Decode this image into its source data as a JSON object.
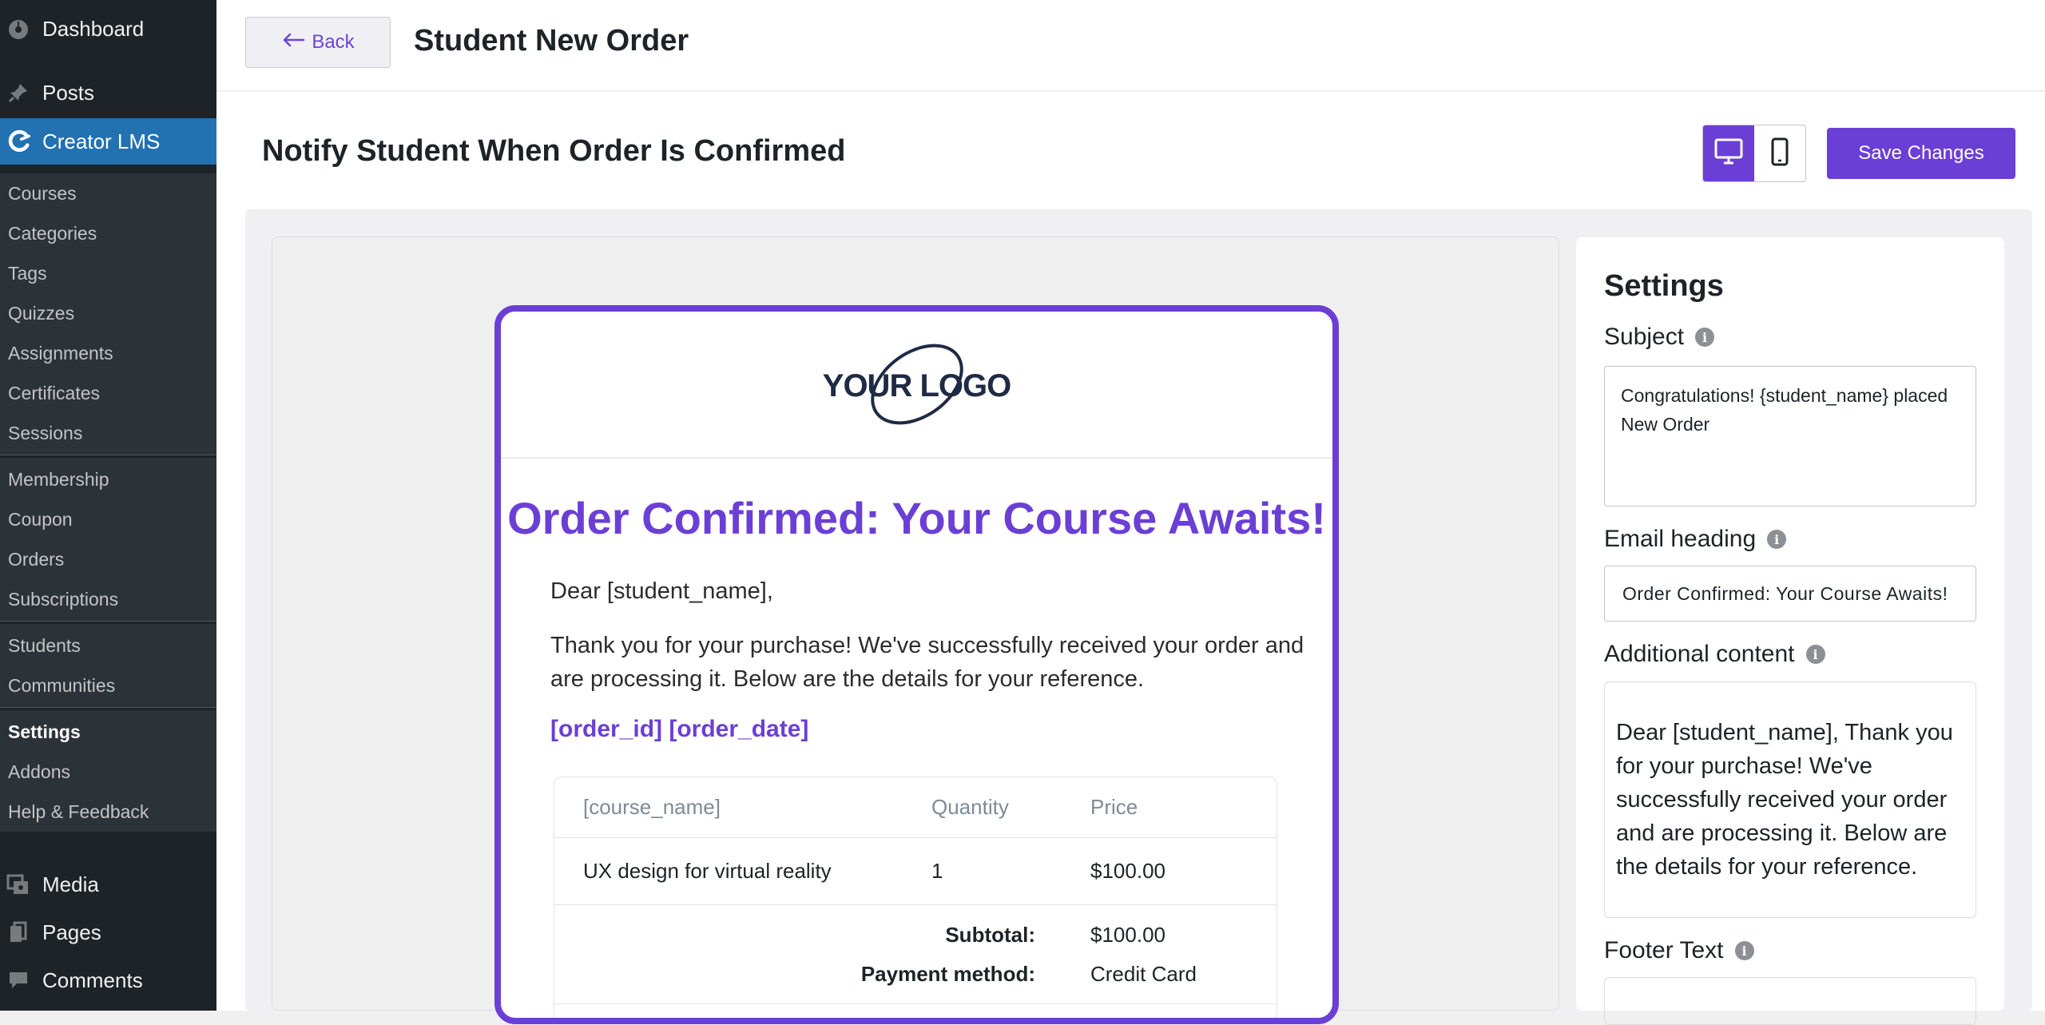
{
  "sidebar": {
    "top_items": [
      {
        "label": "Dashboard",
        "icon": "dashboard-icon"
      },
      {
        "label": "Posts",
        "icon": "pin-icon"
      },
      {
        "label": "Creator LMS",
        "icon": "creator-lms-icon"
      }
    ],
    "submenu": [
      "Courses",
      "Categories",
      "Tags",
      "Quizzes",
      "Assignments",
      "Certificates",
      "Sessions",
      "Membership",
      "Coupon",
      "Orders",
      "Subscriptions",
      "Students",
      "Communities",
      "Settings",
      "Addons",
      "Help & Feedback"
    ],
    "bottom_items": [
      {
        "label": "Media",
        "icon": "media-icon"
      },
      {
        "label": "Pages",
        "icon": "pages-icon"
      },
      {
        "label": "Comments",
        "icon": "comments-icon"
      }
    ]
  },
  "header": {
    "back_label": "Back",
    "title": "Student New Order"
  },
  "main": {
    "section_title": "Notify Student When Order Is Confirmed",
    "save_label": "Save Changes"
  },
  "email": {
    "logo_text": "YOUR LOGO",
    "heading": "Order Confirmed: Your Course Awaits!",
    "greeting": "Dear [student_name],",
    "body": "Thank you for your purchase! We've successfully received your order and are processing it. Below are the details for your reference.",
    "order_ref": "[order_id] [order_date]",
    "table": {
      "headers": [
        "[course_name]",
        "Quantity",
        "Price"
      ],
      "row": [
        "UX design for virtual reality",
        "1",
        "$100.00"
      ],
      "subtotal_label": "Subtotal:",
      "subtotal_value": "$100.00",
      "payment_label": "Payment method:",
      "payment_value": "Credit Card"
    }
  },
  "settings": {
    "title": "Settings",
    "subject_label": "Subject",
    "subject_value": "Congratulations! {student_name} placed New Order",
    "email_heading_label": "Email heading",
    "email_heading_value": "Order Confirmed: Your Course Awaits!",
    "additional_content_label": "Additional content",
    "additional_content_value": "Dear [student_name], Thank you for your purchase! We've successfully received your order and are processing it. Below are the details for your reference.",
    "footer_text_label": "Footer Text"
  },
  "colors": {
    "accent": "#6b3fd6",
    "sidebar_bg": "#1d2327",
    "sidebar_active": "#2271b1"
  }
}
